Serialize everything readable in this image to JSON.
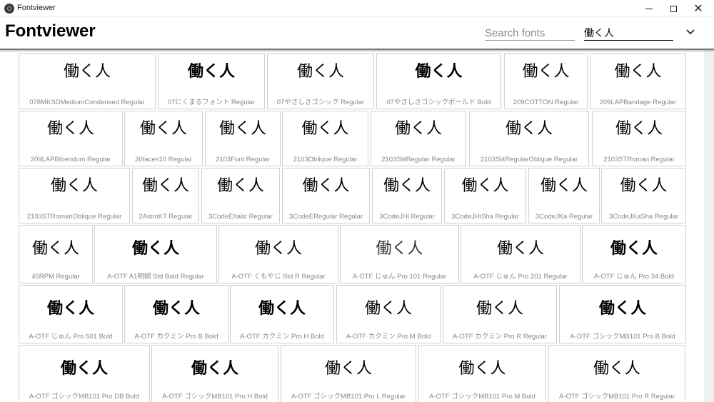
{
  "window": {
    "title": "Fontviewer"
  },
  "header": {
    "title": "Fontviewer",
    "search_placeholder": "Search fonts",
    "sample_text": "働く人",
    "dropdown_icon": "chevron-down-icon"
  },
  "cards": [
    {
      "sample": "働く人",
      "name": "078MKSDMediumCondensed Regular",
      "style": "normal"
    },
    {
      "sample": "働く人",
      "name": "07にくまるフォント Regular",
      "style": "bold"
    },
    {
      "sample": "働く人",
      "name": "07やさしさゴシック Regular",
      "style": "normal"
    },
    {
      "sample": "働く人",
      "name": "07やさしさゴシックボールド Bold",
      "style": "bold"
    },
    {
      "sample": "働く人",
      "name": "209COTTON Regular",
      "style": "normal"
    },
    {
      "sample": "働く人",
      "name": "209LAPBandage Regular",
      "style": "normal"
    },
    {
      "sample": "働く人",
      "name": "209LAPBibendum Regular",
      "style": "normal"
    },
    {
      "sample": "働く人",
      "name": "20faces10 Regular",
      "style": "normal"
    },
    {
      "sample": "働く人",
      "name": "2103Font Regular",
      "style": "normal"
    },
    {
      "sample": "働く人",
      "name": "2103Oblique Regular",
      "style": "normal"
    },
    {
      "sample": "働く人",
      "name": "2103SlitRegular Regular",
      "style": "normal"
    },
    {
      "sample": "働く人",
      "name": "2103SlitRegularOblique Regular",
      "style": "normal"
    },
    {
      "sample": "働く人",
      "name": "2103STRoman Regular",
      "style": "normal"
    },
    {
      "sample": "働く人",
      "name": "2103STRomanOblique Regular",
      "style": "normal"
    },
    {
      "sample": "働く人",
      "name": "2AstroKT Regular",
      "style": "normal"
    },
    {
      "sample": "働く人",
      "name": "3CodeEItalic Regular",
      "style": "normal"
    },
    {
      "sample": "働く人",
      "name": "3CodeERegular Regular",
      "style": "normal"
    },
    {
      "sample": "働く人",
      "name": "3CodeJHi Regular",
      "style": "normal"
    },
    {
      "sample": "働く人",
      "name": "3CodeJHiSha Regular",
      "style": "normal"
    },
    {
      "sample": "働く人",
      "name": "3CodeJKa Regular",
      "style": "normal"
    },
    {
      "sample": "働く人",
      "name": "3CodeJKaSha Regular",
      "style": "normal"
    },
    {
      "sample": "働く人",
      "name": "45RPM Regular",
      "style": "normal"
    },
    {
      "sample": "働く人",
      "name": "A-OTF A1明朝 Std Bold Regular",
      "style": "bold"
    },
    {
      "sample": "働く人",
      "name": "A-OTF くもやじ Std R Regular",
      "style": "normal"
    },
    {
      "sample": "働く人",
      "name": "A-OTF じゅん Pro 101 Regular",
      "style": "light"
    },
    {
      "sample": "働く人",
      "name": "A-OTF じゅん Pro 201 Regular",
      "style": "normal"
    },
    {
      "sample": "働く人",
      "name": "A-OTF じゅん Pro 34 Bold",
      "style": "bold"
    },
    {
      "sample": "働く人",
      "name": "A-OTF じゅん Pro 501 Bold",
      "style": "bold"
    },
    {
      "sample": "働く人",
      "name": "A-OTF カクミン Pro B Bold",
      "style": "bold"
    },
    {
      "sample": "働く人",
      "name": "A-OTF カクミン Pro H Bold",
      "style": "bold"
    },
    {
      "sample": "働く人",
      "name": "A-OTF カクミン Pro M Bold",
      "style": "normal"
    },
    {
      "sample": "働く人",
      "name": "A-OTF カクミン Pro R Regular",
      "style": "normal"
    },
    {
      "sample": "働く人",
      "name": "A-OTF ゴシックMB101 Pro B Bold",
      "style": "bold"
    },
    {
      "sample": "働く人",
      "name": "A-OTF ゴシックMB101 Pro DB Bold",
      "style": "bold"
    },
    {
      "sample": "働く人",
      "name": "A-OTF ゴシックMB101 Pro H Bold",
      "style": "bold"
    },
    {
      "sample": "働く人",
      "name": "A-OTF ゴシックMB101 Pro L Regular",
      "style": "normal"
    },
    {
      "sample": "働く人",
      "name": "A-OTF ゴシックMB101 Pro M Bold",
      "style": "normal"
    },
    {
      "sample": "働く人",
      "name": "A-OTF ゴシックMB101 Pro R Regular",
      "style": "normal"
    }
  ]
}
